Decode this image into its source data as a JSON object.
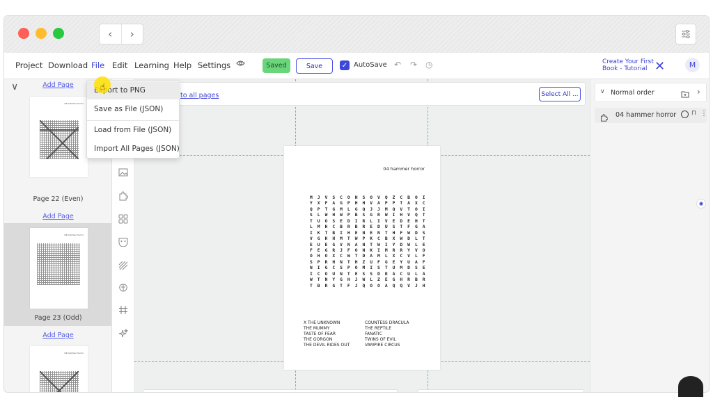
{
  "window": {
    "traffic_lights": {
      "close": "#ff5f57",
      "minimize": "#febc2e",
      "maximize": "#28c840"
    },
    "nav_back": "‹",
    "nav_forward": "›"
  },
  "menubar": {
    "items": [
      "Project",
      "Download",
      "File",
      "Edit",
      "Learning",
      "Help",
      "Settings"
    ],
    "saved_badge": "Saved",
    "save_label": "Save",
    "autosave_label": "AutoSave",
    "autosave_checked": true,
    "tutorial_link": "Create Your First Book - Tutorial",
    "avatar_initial": "M"
  },
  "file_menu": {
    "items": [
      "Export to PNG",
      "Save as File (JSON)",
      "Load from File (JSON)",
      "Import All Pages (JSON)"
    ]
  },
  "left_panel": {
    "add_page_label": "Add Page",
    "pages": [
      {
        "label": "Page 22 (Even)",
        "title": "04 hammer horror"
      },
      {
        "label": "Page 23 (Odd)",
        "title": "04 hammer horror"
      },
      {
        "label": "",
        "title": "04 hammer horror"
      }
    ]
  },
  "tools": [
    "image-icon",
    "puzzle-icon",
    "grid-layout-icon",
    "mask-icon",
    "pattern-icon",
    "brain-icon",
    "hashtag-icon",
    "sparkle-icon"
  ],
  "canvas": {
    "apply_link": "to all pages",
    "select_all_label": "Select All ...",
    "page": {
      "title": "04 hammer horror",
      "grid_rows": [
        "M J V S C O N S O V Q Z C B O I",
        "Y X F A G P H H V A P P T A X C",
        "Q P T G M L G Q J J M Q V T O I",
        "S L W H W P B S G R W I H V Q T",
        "T U O S E D I R L I V E D E H T",
        "L M H C B R B R E D U S T F G A",
        "I K T B I H E N E N T H F W D S",
        "V G H H M T W P K C B X W D L T",
        "E U E G V N A N T W I Y D W L E",
        "F E G R J F O N K I M R R Y V O",
        "O H O X C W T D A M L X C V L F",
        "S P R H N T H Z U F G E Y U A F",
        "N I G C S P O M I S T U M D S E",
        "I C O U N T E S S D R A C U L A",
        "W T N Y G H J W L Z E G H R B R",
        "T B R G T F J Q O O A Q Q V J H"
      ],
      "words": [
        "X THE UNKNOWN",
        "COUNTESS DRACULA",
        "THE MUMMY",
        "THE REPTILE",
        "TASTE OF FEAR",
        "FANATIC",
        "THE GORGON",
        "TWINS OF EVIL",
        "THE DEVIL RIDES OUT",
        "VAMPIRE CIRCUS"
      ]
    }
  },
  "right_panel": {
    "order_label": "Normal order",
    "layer_label": "04 hammer horror"
  },
  "colors": {
    "accent": "#3b43d6",
    "saved": "#6bd57c",
    "guide": "#5ad25a"
  }
}
